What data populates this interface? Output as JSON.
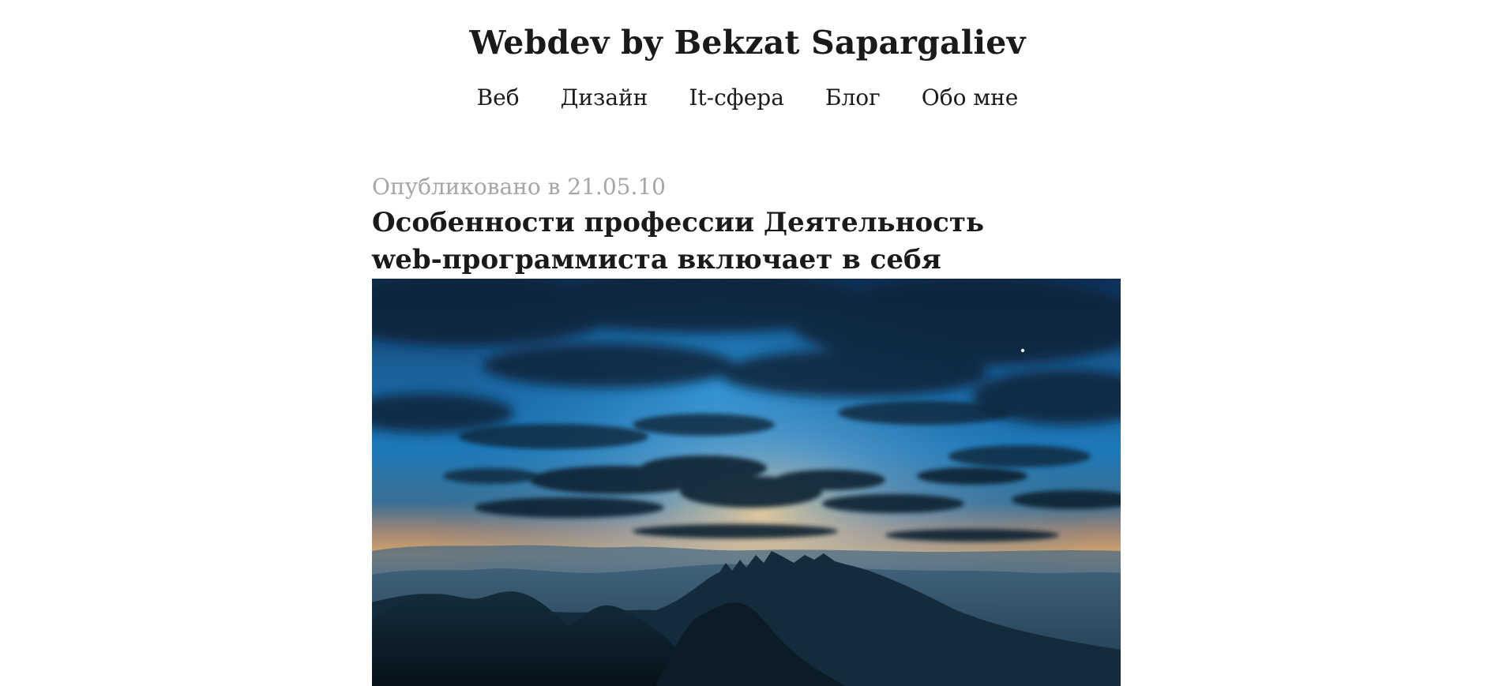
{
  "site": {
    "title": "Webdev by Bekzat Sapargaliev"
  },
  "nav": {
    "items": [
      {
        "label": "Веб"
      },
      {
        "label": "Дизайн"
      },
      {
        "label": "It-сфера"
      },
      {
        "label": "Блог"
      },
      {
        "label": "Обо мне"
      }
    ]
  },
  "post": {
    "meta": "Опубликовано в 21.05.10",
    "title": "Особенности профессии Деятельность web-программиста включает в себя",
    "image": {
      "subject": "twilight-mountain-landscape"
    }
  },
  "colors": {
    "text": "#1a1a1a",
    "meta": "#a3a7a6",
    "background": "#ffffff",
    "sky_top": "#0f2f57",
    "sky_mid": "#1d78b8",
    "horizon_glow": "#d7a56c",
    "mountains": "#0b1c27"
  }
}
